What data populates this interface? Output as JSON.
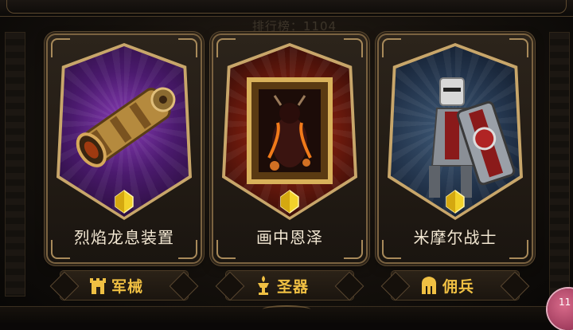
{
  "header": {
    "rank_text": "排行榜：1104"
  },
  "cards": [
    {
      "title": "烈焰龙息装置",
      "category": "军械",
      "category_icon": "castle-tower-icon",
      "art": "steampunk-cannon-artwork"
    },
    {
      "title": "画中恩泽",
      "category": "圣器",
      "category_icon": "chalice-torch-icon",
      "art": "demon-painting-artwork"
    },
    {
      "title": "米摩尔战士",
      "category": "佣兵",
      "category_icon": "spartan-helmet-icon",
      "art": "armored-knight-artwork"
    }
  ],
  "badge": {
    "text": "11"
  },
  "colors": {
    "gold": "#f0c043",
    "frame": "#7a6240",
    "title_text": "#f2e7d2"
  }
}
